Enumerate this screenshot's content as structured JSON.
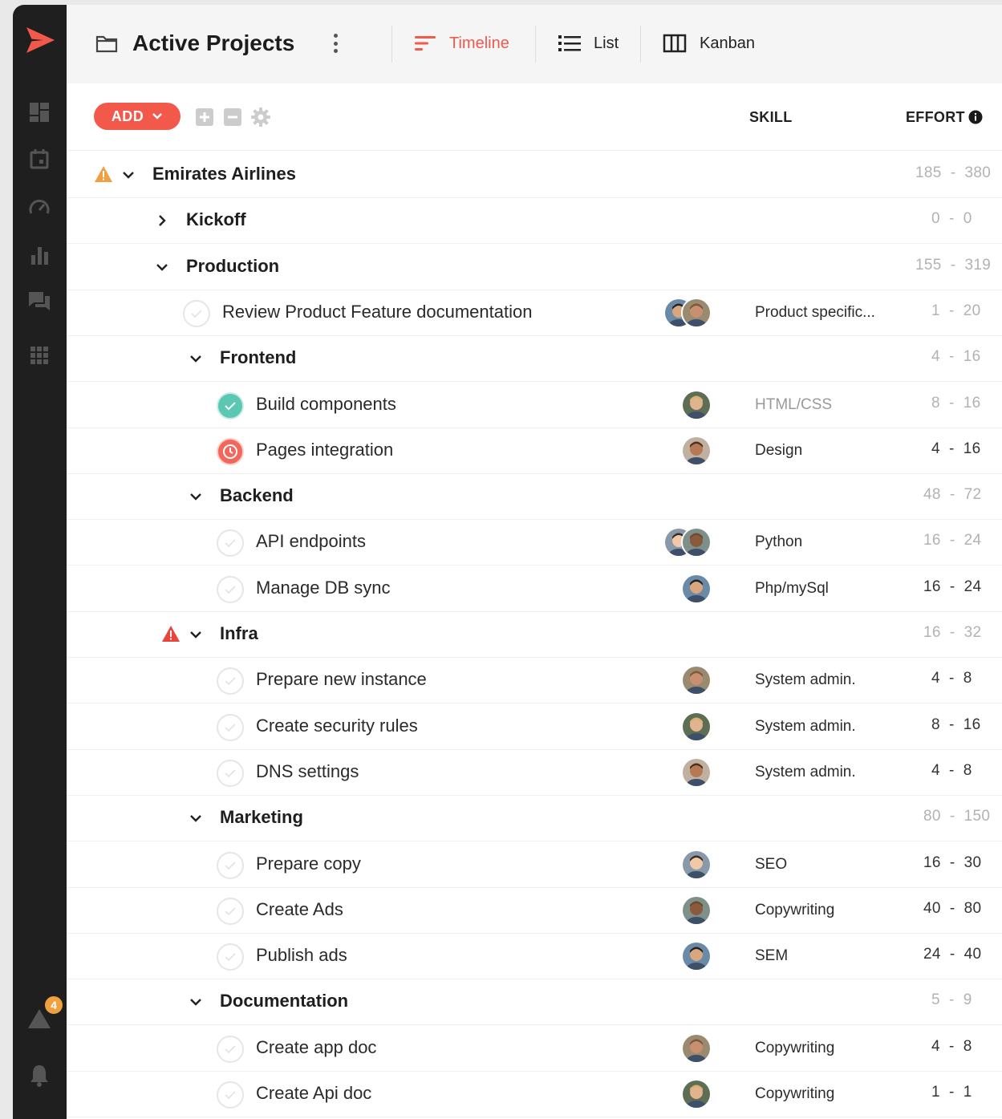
{
  "header": {
    "title": "Active Projects",
    "views": [
      {
        "label": "Timeline",
        "active": true
      },
      {
        "label": "List",
        "active": false
      },
      {
        "label": "Kanban",
        "active": false
      }
    ]
  },
  "toolbar": {
    "add_label": "ADD",
    "columns": {
      "skill": "SKILL",
      "effort": "EFFORT"
    }
  },
  "sidebar": {
    "alert_count": "4",
    "items": [
      "dashboard-icon",
      "calendar-icon",
      "gauge-icon",
      "bar-chart-icon",
      "chat-icon",
      "apps-grid-icon",
      "warning-icon",
      "bell-icon"
    ]
  },
  "colors": {
    "accent": "#f2594b",
    "done": "#5cc7b2",
    "warning": "#f0a040",
    "danger": "#e8453c",
    "sidebar": "#1f1f1f"
  },
  "rows": [
    {
      "type": "group",
      "level": 0,
      "name": "Emirates Airlines",
      "expanded": true,
      "warning": "orange",
      "effort": "185  -  380",
      "effort_dark": false
    },
    {
      "type": "group",
      "level": 1,
      "name": "Kickoff",
      "expanded": false,
      "effort": "0  -  0",
      "effort_dark": false
    },
    {
      "type": "group",
      "level": 1,
      "name": "Production",
      "expanded": true,
      "effort": "155  -  319",
      "effort_dark": false
    },
    {
      "type": "task",
      "level": 2,
      "name": "Review Product Feature documentation",
      "status": "open",
      "avatars": 2,
      "skill": "Product specific...",
      "skill_muted": false,
      "effort": "1  -  20",
      "effort_dark": false
    },
    {
      "type": "group",
      "level": 2,
      "name": "Frontend",
      "expanded": true,
      "effort": "4  -  16",
      "effort_dark": false
    },
    {
      "type": "task",
      "level": 3,
      "name": "Build components",
      "status": "done",
      "avatars": 1,
      "skill": "HTML/CSS",
      "skill_muted": true,
      "effort": "8  -  16",
      "effort_dark": false
    },
    {
      "type": "task",
      "level": 3,
      "name": "Pages integration",
      "status": "late",
      "avatars": 1,
      "skill": "Design",
      "skill_muted": false,
      "effort": "4  -  16",
      "effort_dark": true
    },
    {
      "type": "group",
      "level": 2,
      "name": "Backend",
      "expanded": true,
      "effort": "48  -  72",
      "effort_dark": false
    },
    {
      "type": "task",
      "level": 3,
      "name": "API endpoints",
      "status": "open",
      "avatars": 2,
      "skill": "Python",
      "skill_muted": false,
      "effort": "16  -  24",
      "effort_dark": false
    },
    {
      "type": "task",
      "level": 3,
      "name": "Manage DB sync",
      "status": "open",
      "avatars": 1,
      "skill": "Php/mySql",
      "skill_muted": false,
      "effort": "16  -  24",
      "effort_dark": true
    },
    {
      "type": "group",
      "level": 2,
      "name": "Infra",
      "expanded": true,
      "warning": "red",
      "effort": "16  -  32",
      "effort_dark": false
    },
    {
      "type": "task",
      "level": 3,
      "name": "Prepare new instance",
      "status": "open",
      "avatars": 1,
      "skill": "System admin.",
      "skill_muted": false,
      "effort": "4  -  8",
      "effort_dark": true
    },
    {
      "type": "task",
      "level": 3,
      "name": "Create security rules",
      "status": "open",
      "avatars": 1,
      "skill": "System admin.",
      "skill_muted": false,
      "effort": "8  -  16",
      "effort_dark": true
    },
    {
      "type": "task",
      "level": 3,
      "name": "DNS settings",
      "status": "open",
      "avatars": 1,
      "skill": "System admin.",
      "skill_muted": false,
      "effort": "4  -  8",
      "effort_dark": true
    },
    {
      "type": "group",
      "level": 2,
      "name": "Marketing",
      "expanded": true,
      "effort": "80  -  150",
      "effort_dark": false
    },
    {
      "type": "task",
      "level": 3,
      "name": "Prepare copy",
      "status": "open",
      "avatars": 1,
      "skill": "SEO",
      "skill_muted": false,
      "effort": "16  -  30",
      "effort_dark": true
    },
    {
      "type": "task",
      "level": 3,
      "name": "Create Ads",
      "status": "open",
      "avatars": 1,
      "skill": "Copywriting",
      "skill_muted": false,
      "effort": "40  -  80",
      "effort_dark": true
    },
    {
      "type": "task",
      "level": 3,
      "name": "Publish ads",
      "status": "open",
      "avatars": 1,
      "skill": "SEM",
      "skill_muted": false,
      "effort": "24  -  40",
      "effort_dark": true
    },
    {
      "type": "group",
      "level": 2,
      "name": "Documentation",
      "expanded": true,
      "effort": "5  -  9",
      "effort_dark": false
    },
    {
      "type": "task",
      "level": 3,
      "name": "Create app doc",
      "status": "open",
      "avatars": 1,
      "skill": "Copywriting",
      "skill_muted": false,
      "effort": "4  -  8",
      "effort_dark": true
    },
    {
      "type": "task",
      "level": 3,
      "name": "Create Api doc",
      "status": "open",
      "avatars": 1,
      "skill": "Copywriting",
      "skill_muted": false,
      "effort": "1  -  1",
      "effort_dark": true
    }
  ]
}
